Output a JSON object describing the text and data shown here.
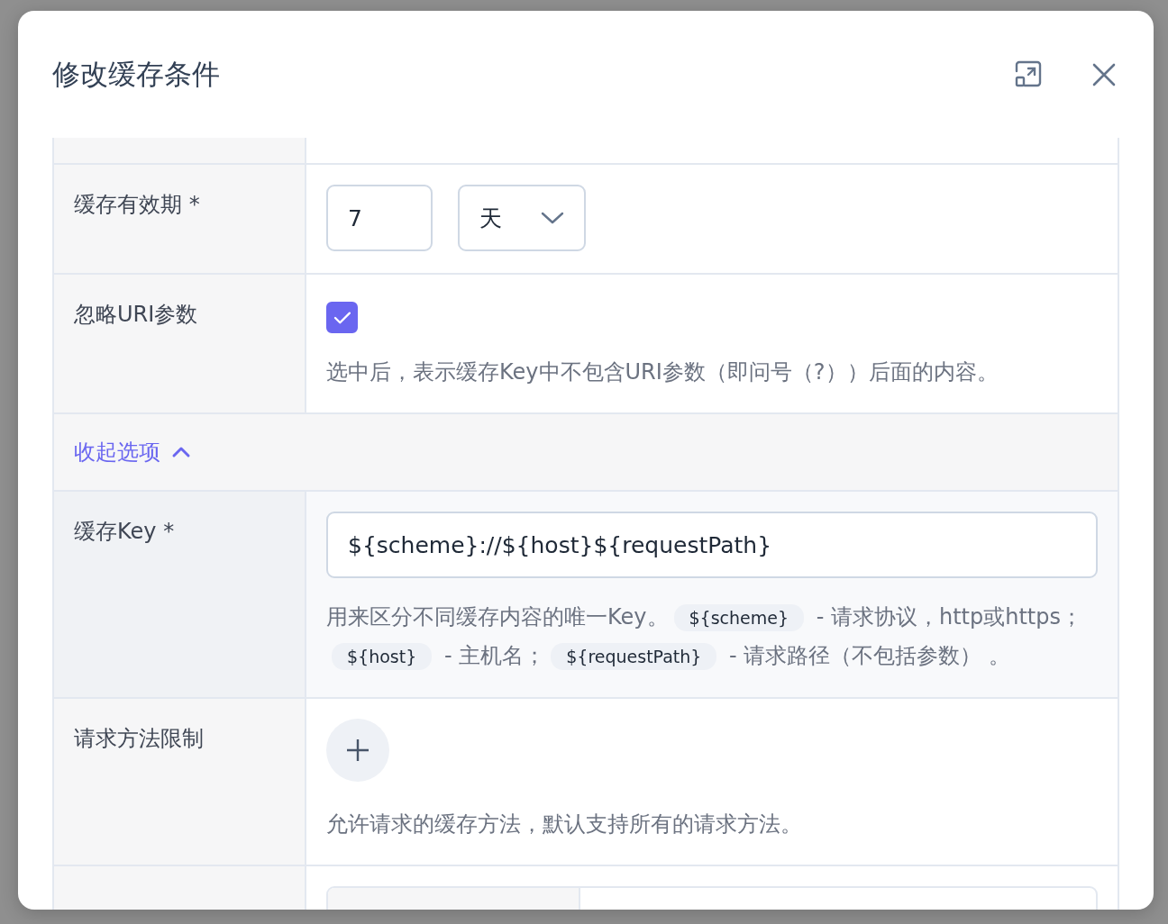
{
  "dialog": {
    "title": "修改缓存条件"
  },
  "rows": [
    {
      "kind": "duration",
      "label": "缓存有效期 *",
      "value": "7",
      "unit": "天"
    },
    {
      "kind": "checkbox",
      "label": "忽略URI参数",
      "checked": true,
      "help": "选中后，表示缓存Key中不包含URI参数（即问号（?））后面的内容。"
    },
    {
      "kind": "toggle",
      "label": "收起选项",
      "expanded": true
    },
    {
      "kind": "text",
      "label": "缓存Key *",
      "value": "${scheme}://${host}${requestPath}",
      "help": [
        {
          "text": "用来区分不同缓存内容的唯一Key。",
          "code": false
        },
        {
          "text": "${scheme}",
          "code": true
        },
        {
          "text": " - 请求协议，http或https；",
          "code": false
        },
        {
          "text": "${host}",
          "code": true
        },
        {
          "text": " - 主机名；",
          "code": false
        },
        {
          "text": "${requestPath}",
          "code": true
        },
        {
          "text": " - 请求路径（不包括参数） 。",
          "code": false
        }
      ]
    },
    {
      "kind": "add",
      "label": "请求方法限制",
      "help": "允许请求的缓存方法，默认支持所有的请求方法。"
    },
    {
      "kind": "partial"
    }
  ]
}
